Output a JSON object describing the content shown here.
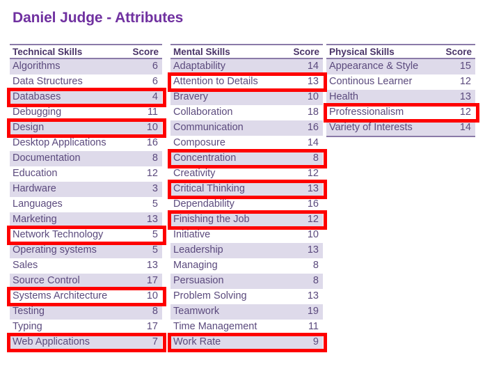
{
  "title": "Daniel Judge - Attributes",
  "colors": {
    "title": "#7031a0",
    "highlight": "#fe0000",
    "row_alt": "#dedaea",
    "text": "#5b4a7d",
    "rule": "#8a7aa8"
  },
  "tables": [
    {
      "id": "technical",
      "header": {
        "name": "Technical Skills",
        "score": "Score"
      },
      "rows": [
        {
          "name": "Algorithms",
          "score": "6",
          "highlighted": false
        },
        {
          "name": "Data Structures",
          "score": "6",
          "highlighted": false
        },
        {
          "name": "Databases",
          "score": "4",
          "highlighted": true
        },
        {
          "name": "Debugging",
          "score": "11",
          "highlighted": false
        },
        {
          "name": "Design",
          "score": "10",
          "highlighted": true
        },
        {
          "name": "Desktop Applications",
          "score": "16",
          "highlighted": false
        },
        {
          "name": "Documentation",
          "score": "8",
          "highlighted": false
        },
        {
          "name": "Education",
          "score": "12",
          "highlighted": false
        },
        {
          "name": "Hardware",
          "score": "3",
          "highlighted": false
        },
        {
          "name": "Languages",
          "score": "5",
          "highlighted": false
        },
        {
          "name": "Marketing",
          "score": "13",
          "highlighted": false
        },
        {
          "name": "Network Technology",
          "score": "5",
          "highlighted": true
        },
        {
          "name": "Operating systems",
          "score": "5",
          "highlighted": false
        },
        {
          "name": "Sales",
          "score": "13",
          "highlighted": false
        },
        {
          "name": "Source Control",
          "score": "17",
          "highlighted": false
        },
        {
          "name": "Systems Architecture",
          "score": "10",
          "highlighted": true
        },
        {
          "name": "Testing",
          "score": "8",
          "highlighted": false
        },
        {
          "name": "Typing",
          "score": "17",
          "highlighted": false
        },
        {
          "name": "Web Applications",
          "score": "7",
          "highlighted": true
        }
      ]
    },
    {
      "id": "mental",
      "header": {
        "name": "Mental Skills",
        "score": "Score"
      },
      "rows": [
        {
          "name": "Adaptability",
          "score": "14",
          "highlighted": false
        },
        {
          "name": "Attention to Details",
          "score": "13",
          "highlighted": true
        },
        {
          "name": "Bravery",
          "score": "10",
          "highlighted": false
        },
        {
          "name": "Collaboration",
          "score": "18",
          "highlighted": false
        },
        {
          "name": "Communication",
          "score": "16",
          "highlighted": false
        },
        {
          "name": "Composure",
          "score": "14",
          "highlighted": false
        },
        {
          "name": "Concentration",
          "score": "8",
          "highlighted": true
        },
        {
          "name": "Creativity",
          "score": "12",
          "highlighted": false
        },
        {
          "name": "Critical Thinking",
          "score": "13",
          "highlighted": true
        },
        {
          "name": "Dependability",
          "score": "16",
          "highlighted": false
        },
        {
          "name": "Finishing the Job",
          "score": "12",
          "highlighted": true
        },
        {
          "name": "Initiative",
          "score": "10",
          "highlighted": false
        },
        {
          "name": "Leadership",
          "score": "13",
          "highlighted": false
        },
        {
          "name": "Managing",
          "score": "8",
          "highlighted": false
        },
        {
          "name": "Persuasion",
          "score": "8",
          "highlighted": false
        },
        {
          "name": "Problem Solving",
          "score": "13",
          "highlighted": false
        },
        {
          "name": "Teamwork",
          "score": "19",
          "highlighted": false
        },
        {
          "name": "Time Management",
          "score": "11",
          "highlighted": false
        },
        {
          "name": "Work Rate",
          "score": "9",
          "highlighted": true
        }
      ]
    },
    {
      "id": "physical",
      "header": {
        "name": "Physical Skills",
        "score": "Score"
      },
      "rows": [
        {
          "name": "Appearance & Style",
          "score": "15",
          "highlighted": false
        },
        {
          "name": "Continous Learner",
          "score": "12",
          "highlighted": false
        },
        {
          "name": "Health",
          "score": "13",
          "highlighted": false
        },
        {
          "name": "Profressionalism",
          "score": "12",
          "highlighted": true
        },
        {
          "name": "Variety of Interests",
          "score": "14",
          "highlighted": false
        }
      ]
    }
  ]
}
